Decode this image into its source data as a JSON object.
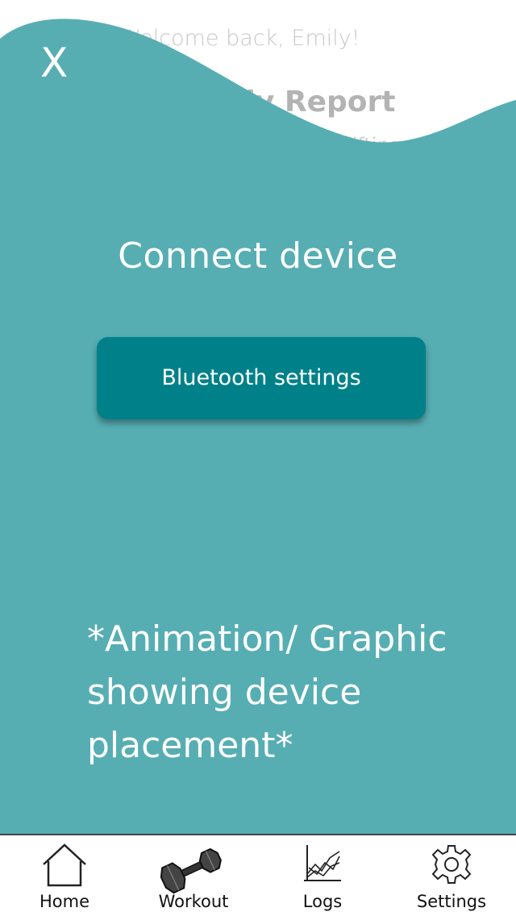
{
  "background": {
    "greeting": "Welcome back, Emily!",
    "title": "Daily Report",
    "subtitle": "lifting"
  },
  "modal": {
    "close_label": "X",
    "title": "Connect device",
    "bluetooth_button_label": "Bluetooth settings",
    "placeholder_text": "*Animation/ Graphic showing device placement*"
  },
  "tabbar": {
    "items": [
      {
        "label": "Home",
        "icon": "house-icon"
      },
      {
        "label": "Workout",
        "icon": "dumbbell-icon"
      },
      {
        "label": "Logs",
        "icon": "line-chart-icon"
      },
      {
        "label": "Settings",
        "icon": "gear-icon"
      }
    ]
  },
  "colors": {
    "overlay": "#56aeb3",
    "button": "#008189",
    "text_on_overlay": "#ffffff"
  }
}
